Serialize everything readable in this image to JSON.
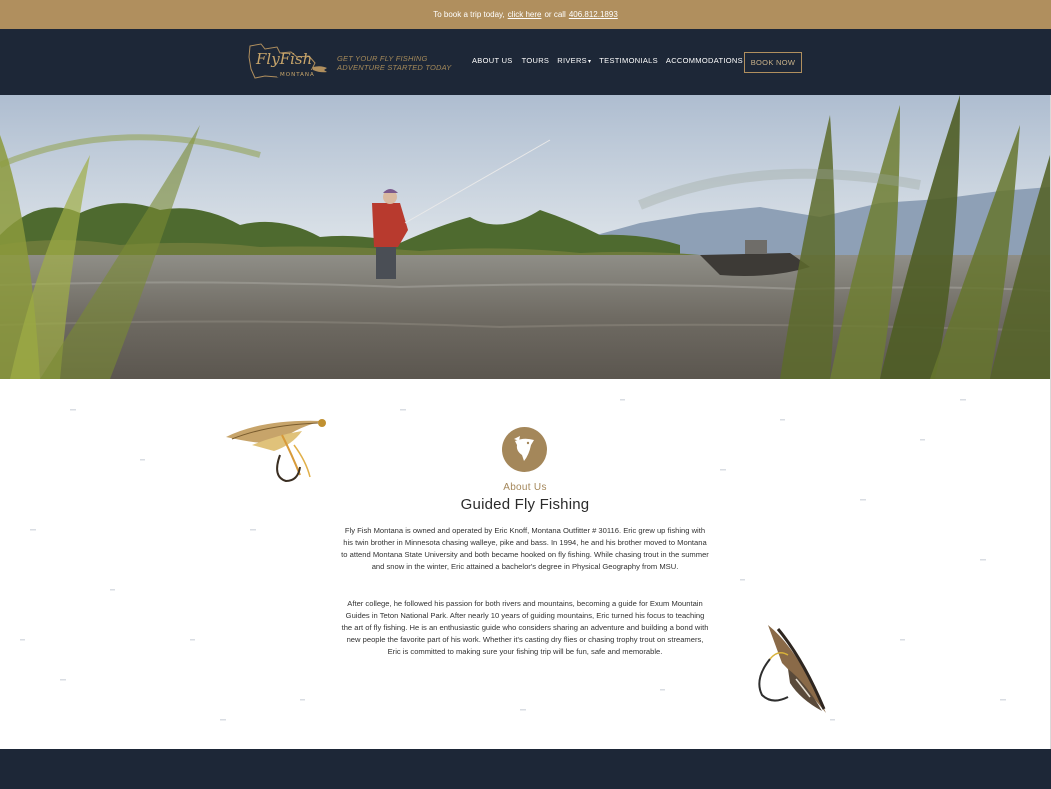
{
  "topbar": {
    "prefix": "To book a trip today,",
    "link_label": "click here",
    "middle": "or call",
    "phone": "406.812.1893"
  },
  "header": {
    "logo_text_main": "FlyFish",
    "logo_text_sub": "MONTANA",
    "tagline_line1": "GET YOUR FLY FISHING",
    "tagline_line2": "ADVENTURE STARTED TODAY",
    "nav": [
      {
        "label": "ABOUT US"
      },
      {
        "label": "TOURS"
      },
      {
        "label": "RIVERS"
      },
      {
        "label": "TESTIMONIALS"
      },
      {
        "label": "ACCOMMODATIONS"
      }
    ],
    "book_label": "BOOK NOW"
  },
  "about": {
    "eyebrow": "About Us",
    "title": "Guided Fly Fishing",
    "paragraph1": "Fly Fish Montana is owned and operated by Eric Knoff, Montana Outfitter # 30116. Eric grew up fishing with his twin brother in Minnesota chasing walleye, pike and bass. In 1994, he and his brother moved to Montana to attend Montana State University and both became hooked on fly fishing. While chasing trout in the summer and snow in the winter, Eric attained a bachelor's degree in Physical Geography from MSU.",
    "paragraph2": "After college, he followed his passion for both rivers and mountains, becoming a guide for Exum Mountain Guides in Teton National Park. After nearly 10 years of guiding mountains, Eric turned his focus to teaching the art of fly fishing. He is an enthusiastic guide who considers sharing an adventure and building a bond with new people the favorite part of his work. Whether it's casting dry flies or chasing trophy trout on streamers, Eric is committed to making sure your fishing trip will be fun, safe and memorable."
  },
  "colors": {
    "gold": "#b08f5e",
    "navy": "#1d2737",
    "badge": "#a4875a"
  },
  "icons": {
    "badge": "fish-icon",
    "rivers_dropdown": "caret-down-icon"
  }
}
